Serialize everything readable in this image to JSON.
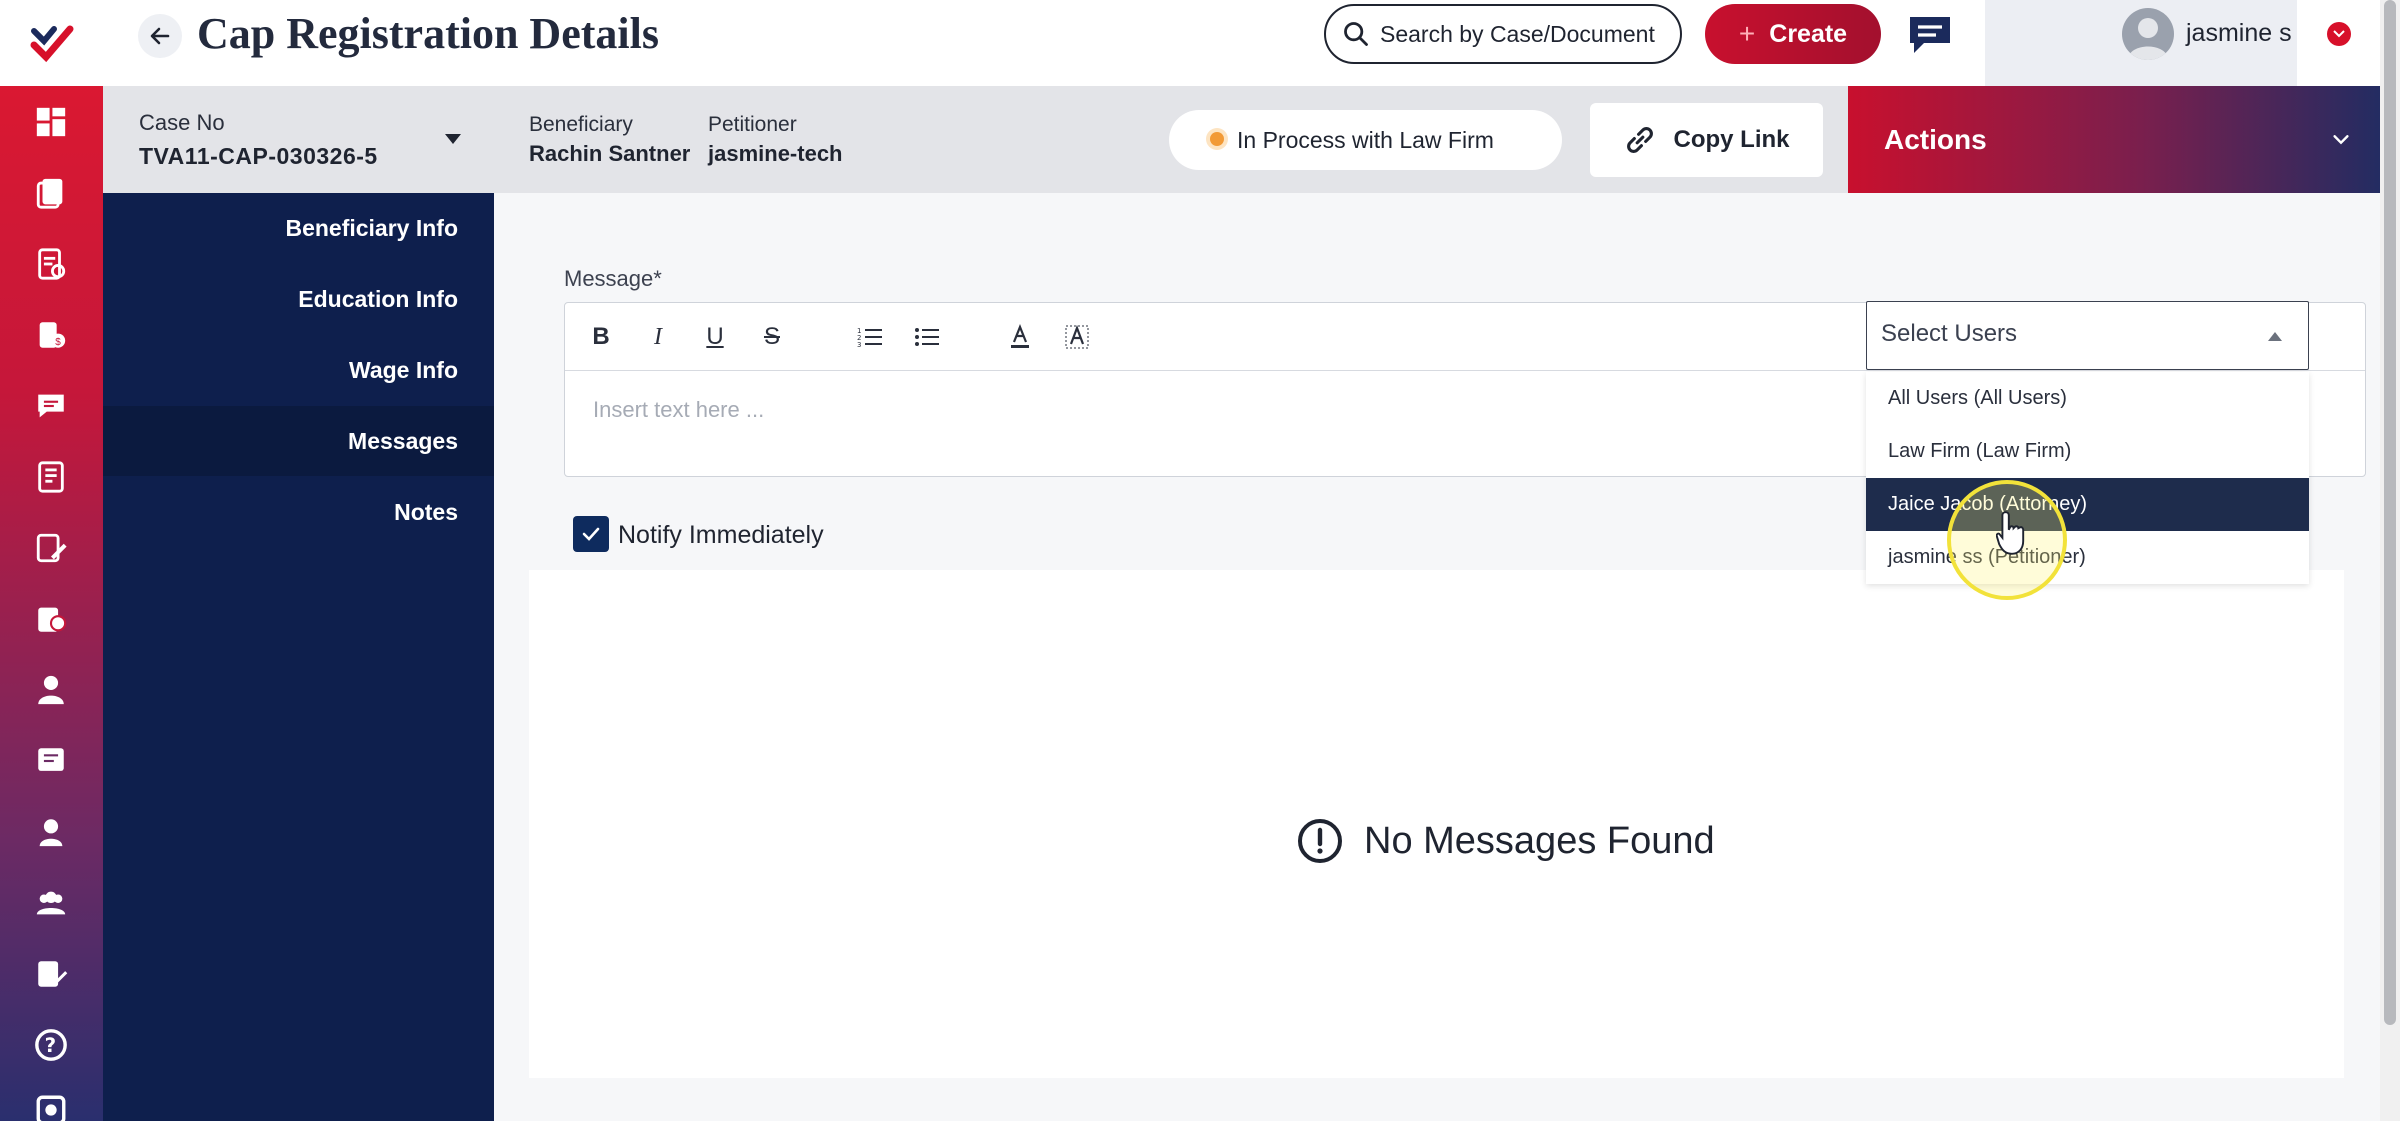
{
  "header": {
    "title": "Cap Registration Details",
    "search_placeholder": "Search by Case/Document",
    "create_label": "Create",
    "user_name": "jasmine s"
  },
  "case": {
    "case_no_label": "Case No",
    "case_no": "TVA11-CAP-030326-5",
    "beneficiary_label": "Beneficiary",
    "beneficiary": "Rachin Santner",
    "petitioner_label": "Petitioner",
    "petitioner": "jasmine-tech",
    "status": "In Process with Law Firm",
    "copy_link_label": "Copy Link",
    "actions_label": "Actions"
  },
  "sidenav": {
    "items": [
      {
        "label": "Beneficiary Info",
        "active": false
      },
      {
        "label": "Education Info",
        "active": false
      },
      {
        "label": "Wage Info",
        "active": false
      },
      {
        "label": "Messages",
        "active": true
      },
      {
        "label": "Notes",
        "active": false
      }
    ]
  },
  "message_form": {
    "label": "Message*",
    "editor_placeholder": "Insert text here ...",
    "toolbar": [
      "bold",
      "italic",
      "underline",
      "strikethrough",
      "ordered-list",
      "bullet-list",
      "font-color",
      "clear-formatting"
    ],
    "notify_label": "Notify Immediately",
    "notify_checked": true
  },
  "select_users": {
    "placeholder": "Select Users",
    "options": [
      "All Users (All Users)",
      "Law Firm (Law Firm)",
      "Jaice Jacob (Attorney)",
      "jasmine ss (Petitioner)"
    ],
    "highlighted_index": 2
  },
  "messages": {
    "empty_text": "No Messages Found"
  },
  "rail_icons": [
    "dashboard-icon",
    "documents-icon",
    "forms-icon",
    "cases-icon",
    "chat-icon",
    "reports-icon",
    "edit-icon",
    "certificate-icon",
    "user-icon",
    "notes-icon",
    "profile-icon",
    "team-icon",
    "task-icon",
    "help-icon",
    "settings-icon"
  ],
  "colors": {
    "brand_red": "#c8102e",
    "nav_navy": "#0e1f4d",
    "highlight_row": "#1e2c4c",
    "status_dot": "#f29a36"
  }
}
